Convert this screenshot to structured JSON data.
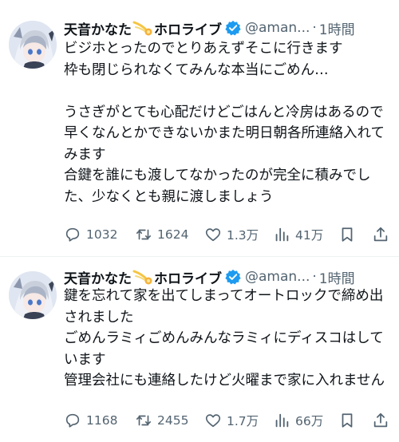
{
  "tweets": [
    {
      "author": {
        "name_prefix": "天音かなた",
        "name_suffix": "ホロライブ",
        "handle": "@aman...",
        "separator": "·",
        "time": "1時間",
        "emoji_icon": "comet-emoji-icon",
        "verified_icon": "verified-badge-icon"
      },
      "text": "ビジホとったのでとりあえずそこに行きます\n枠も閉じられなくてみんな本当にごめん…\n\nうさぎがとても心配だけどごはんと冷房はあるので\n早くなんとかできないかまた明日朝各所連絡入れてみます\n合鍵を誰にも渡してなかったのが完全に積みでした、少なくとも親に渡しましょう",
      "stats": {
        "replies": "1032",
        "retweets": "1624",
        "likes": "1.3万",
        "views": "41万"
      }
    },
    {
      "author": {
        "name_prefix": "天音かなた",
        "name_suffix": "ホロライブ",
        "handle": "@aman...",
        "separator": "·",
        "time": "1時間",
        "emoji_icon": "comet-emoji-icon",
        "verified_icon": "verified-badge-icon"
      },
      "text": "鍵を忘れて家を出てしまってオートロックで締め出されました\nごめんラミィごめんみんなラミィにディスコはしています\n管理会社にも連絡したけど火曜まで家に入れません",
      "stats": {
        "replies": "1168",
        "retweets": "2455",
        "likes": "1.7万",
        "views": "66万"
      }
    }
  ],
  "colors": {
    "text": "#0f1419",
    "secondary": "#536471",
    "verified": "#1d9bf0",
    "divider": "#eff3f4"
  }
}
